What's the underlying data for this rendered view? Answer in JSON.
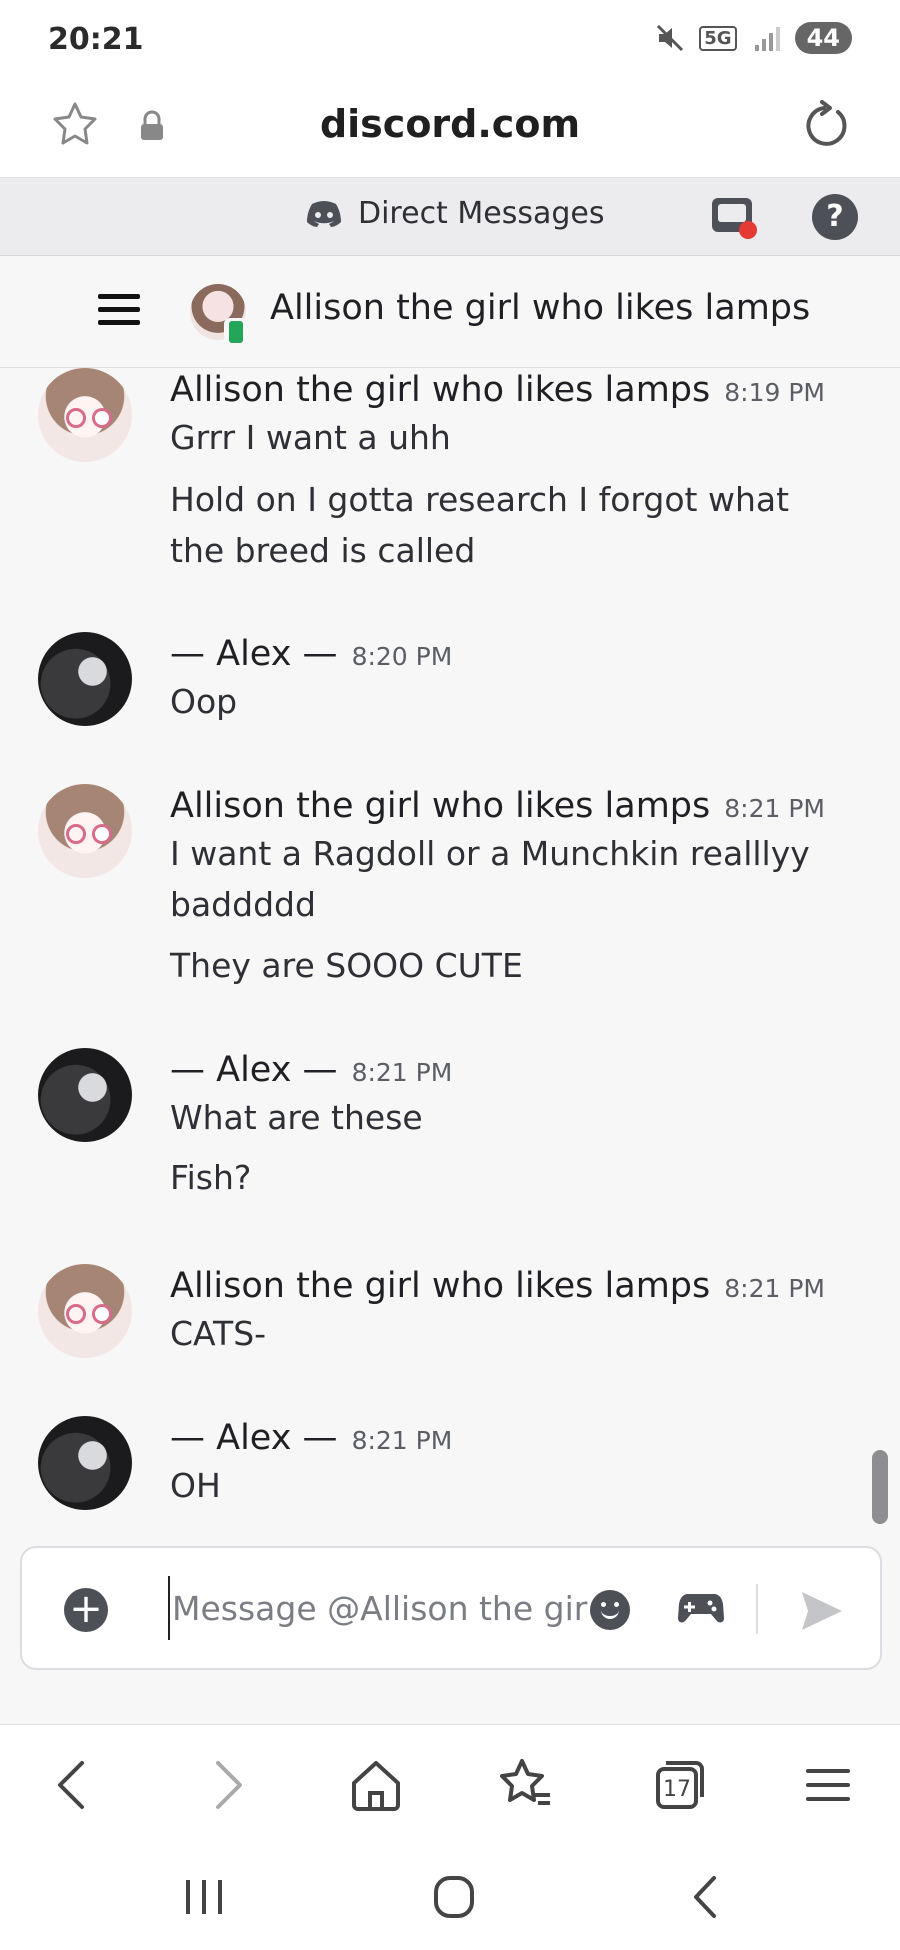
{
  "status_bar": {
    "time": "20:21",
    "network": "5G",
    "battery": "44"
  },
  "browser": {
    "url": "discord.com"
  },
  "dm_header": {
    "title": "Direct Messages"
  },
  "channel": {
    "name": "Allison the girl who likes lamps"
  },
  "messages": [
    {
      "author": "Allison the girl who likes lamps",
      "time": "8:19 PM",
      "lines": [
        "Grrr I want a uhh",
        "Hold on I gotta research I forgot what",
        "the breed is called"
      ]
    },
    {
      "author": "— Alex —",
      "time": "8:20 PM",
      "lines": [
        "Oop"
      ]
    },
    {
      "author": "Allison the girl who likes lamps",
      "time": "8:21 PM",
      "lines": [
        "I want a Ragdoll or a Munchkin realllyy",
        "baddddd",
        "They are SOOO CUTE"
      ]
    },
    {
      "author": "— Alex —",
      "time": "8:21 PM",
      "lines": [
        "What are these",
        "Fish?"
      ]
    },
    {
      "author": "Allison the girl who likes lamps",
      "time": "8:21 PM",
      "lines": [
        "CATS-"
      ]
    },
    {
      "author": "— Alex —",
      "time": "8:21 PM",
      "lines": [
        "OH"
      ]
    }
  ],
  "composer": {
    "placeholder": "Message @Allison the gir"
  },
  "browser_nav": {
    "tabs_count": "17"
  },
  "colors": {
    "accent": "#5865f2",
    "online_mobile": "#23a55a",
    "notification": "#e53935"
  }
}
